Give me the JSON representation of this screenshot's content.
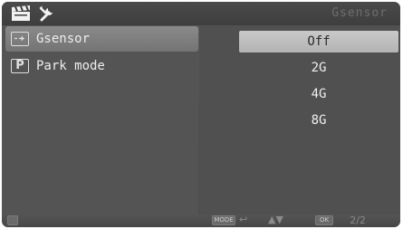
{
  "header": {
    "title": "Gsensor",
    "icons": [
      "clapperboard-icon",
      "wrench-icon"
    ]
  },
  "menu": {
    "items": [
      {
        "label": "Gsensor",
        "icon": "gsensor-icon",
        "selected": true
      },
      {
        "label": "Park mode",
        "icon": "parking-icon",
        "icon_text": "P",
        "selected": false
      }
    ]
  },
  "options": {
    "items": [
      {
        "label": "Off",
        "selected": true
      },
      {
        "label": "2G",
        "selected": false
      },
      {
        "label": "4G",
        "selected": false
      },
      {
        "label": "8G",
        "selected": false
      }
    ]
  },
  "footer": {
    "mode_key": "MODE",
    "back_glyph": "↩",
    "nav_glyph": "▲▼",
    "ok_key": "OK",
    "page": "2/2",
    "icons": [
      "storage-icon",
      "mode-key-icon",
      "back-icon",
      "up-down-icon",
      "ok-key-icon"
    ]
  },
  "colors": {
    "selected_menu_bg": "#7e7e7e",
    "selected_option_bg": "#c0c0c0",
    "panel_bg": "#525252"
  }
}
